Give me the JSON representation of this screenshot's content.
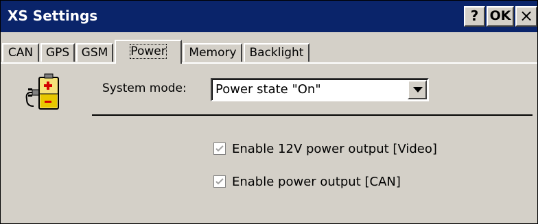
{
  "window": {
    "title": "XS Settings",
    "buttons": {
      "help": "?",
      "ok": "OK",
      "close": "×"
    }
  },
  "tabs": [
    {
      "label": "CAN",
      "active": false
    },
    {
      "label": "GPS",
      "active": false
    },
    {
      "label": "GSM",
      "active": false
    },
    {
      "label": "Power",
      "active": true
    },
    {
      "label": "Memory",
      "active": false
    },
    {
      "label": "Backlight",
      "active": false
    }
  ],
  "power": {
    "icon": "battery-power-icon",
    "system_mode_label": "System mode:",
    "system_mode_value": "Power state \"On\"",
    "options": [
      {
        "label": "Enable 12V power output [Video]",
        "checked": true,
        "enabled": false
      },
      {
        "label": "Enable power output [CAN]",
        "checked": true,
        "enabled": false
      }
    ]
  },
  "colors": {
    "titlebar": "#0a246a",
    "face": "#d4d0c8"
  }
}
